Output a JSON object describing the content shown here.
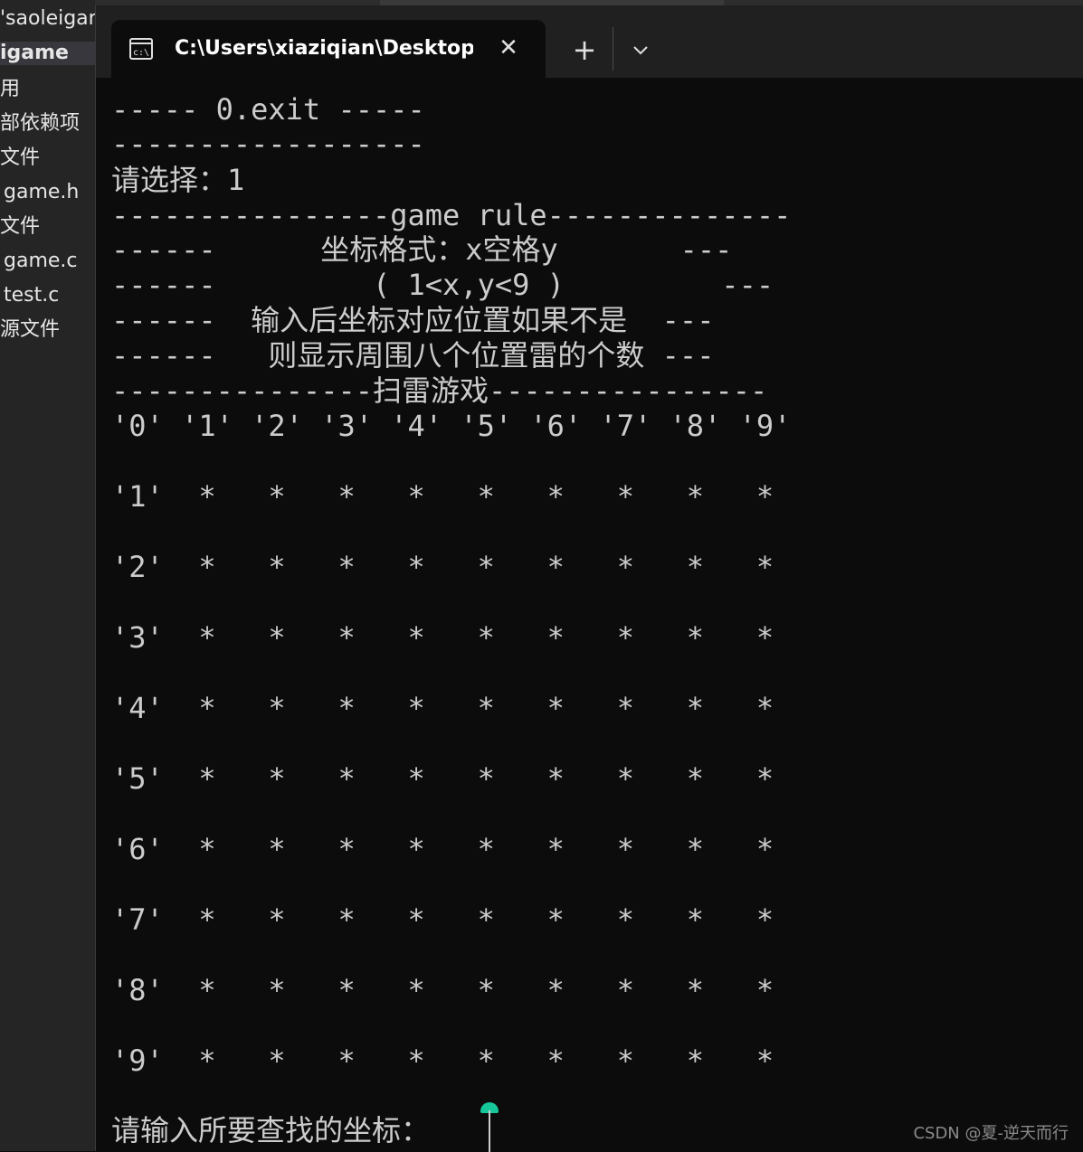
{
  "sidebar": {
    "items": [
      "'saoleigam",
      "igame",
      "用",
      "部依赖项",
      "文件",
      "game.h",
      "文件",
      "game.c",
      "test.c",
      "源文件"
    ]
  },
  "terminal": {
    "tab_title": "C:\\Users\\xiaziqian\\Desktop\\al",
    "close_glyph": "✕",
    "new_tab_glyph": "+",
    "lines": [
      "----- 0.exit -----",
      "------------------",
      "请选择：1",
      "----------------game rule--------------",
      "------      坐标格式：x空格y       ---",
      "------         ( 1<x,y<9 )         ---",
      "------  输入后坐标对应位置如果不是  ---",
      "------   则显示周围八个位置雷的个数 ---",
      "---------------扫雷游戏----------------",
      "'0' '1' '2' '3' '4' '5' '6' '7' '8' '9'"
    ],
    "grid_rows": [
      "'1'  *   *   *   *   *   *   *   *   *",
      "'2'  *   *   *   *   *   *   *   *   *",
      "'3'  *   *   *   *   *   *   *   *   *",
      "'4'  *   *   *   *   *   *   *   *   *",
      "'5'  *   *   *   *   *   *   *   *   *",
      "'6'  *   *   *   *   *   *   *   *   *",
      "'7'  *   *   *   *   *   *   *   *   *",
      "'8'  *   *   *   *   *   *   *   *   *",
      "'9'  *   *   *   *   *   *   *   *   *"
    ],
    "prompt": "请输入所要查找的坐标："
  },
  "watermark": "CSDN @夏-逆天而行",
  "colors": {
    "background": "#0c0c0c",
    "text": "#cccccc",
    "titlebar": "#202020",
    "cursor_accent": "#16c79a"
  }
}
